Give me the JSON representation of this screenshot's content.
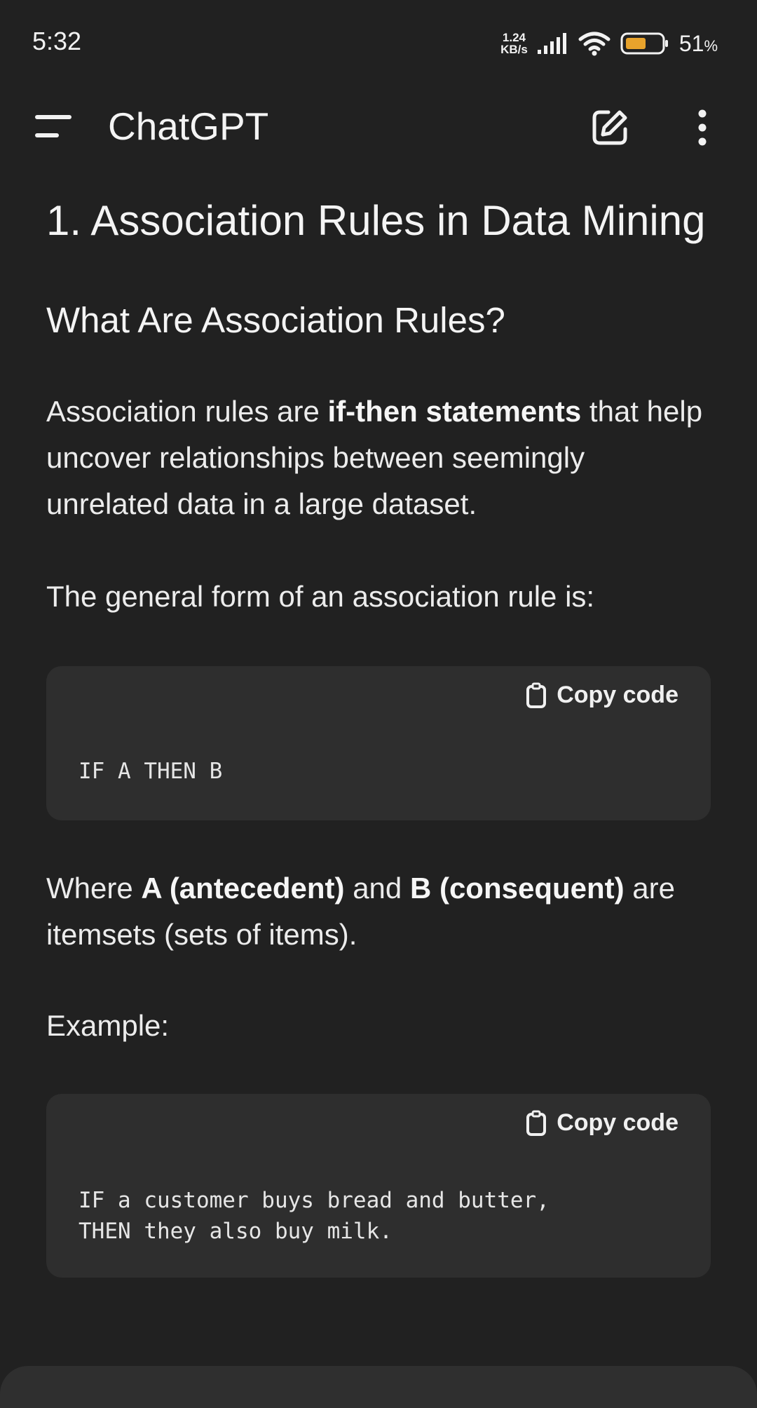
{
  "status_bar": {
    "time": "5:32",
    "net_speed_value": "1.24",
    "net_speed_unit": "KB/s",
    "battery_percent": "51",
    "battery_unit": "%",
    "battery_color": "#e8a32c"
  },
  "app_bar": {
    "title": "ChatGPT",
    "menu_icon": "hamburger-menu-icon",
    "edit_icon": "new-chat-edit-icon",
    "more_icon": "vertical-dots-icon"
  },
  "content": {
    "heading1": "1. Association Rules in Data Mining",
    "heading2": "What Are Association Rules?",
    "para1_pre": "Association rules are ",
    "para1_bold": "if-then statements",
    "para1_post": " that help uncover relationships between seemingly unrelated data in a large dataset.",
    "para2": "The general form of an association rule is:",
    "code1": {
      "copy_label": "Copy code",
      "text": "IF A THEN B"
    },
    "para3_pre": "Where ",
    "para3_bold1": "A (antecedent)",
    "para3_mid": " and ",
    "para3_bold2": "B (consequent)",
    "para3_post": " are itemsets (sets of items).",
    "para4": "Example:",
    "code2": {
      "copy_label": "Copy code",
      "line1": "IF a customer buys bread and butter,",
      "line2": "THEN they also buy milk."
    }
  }
}
